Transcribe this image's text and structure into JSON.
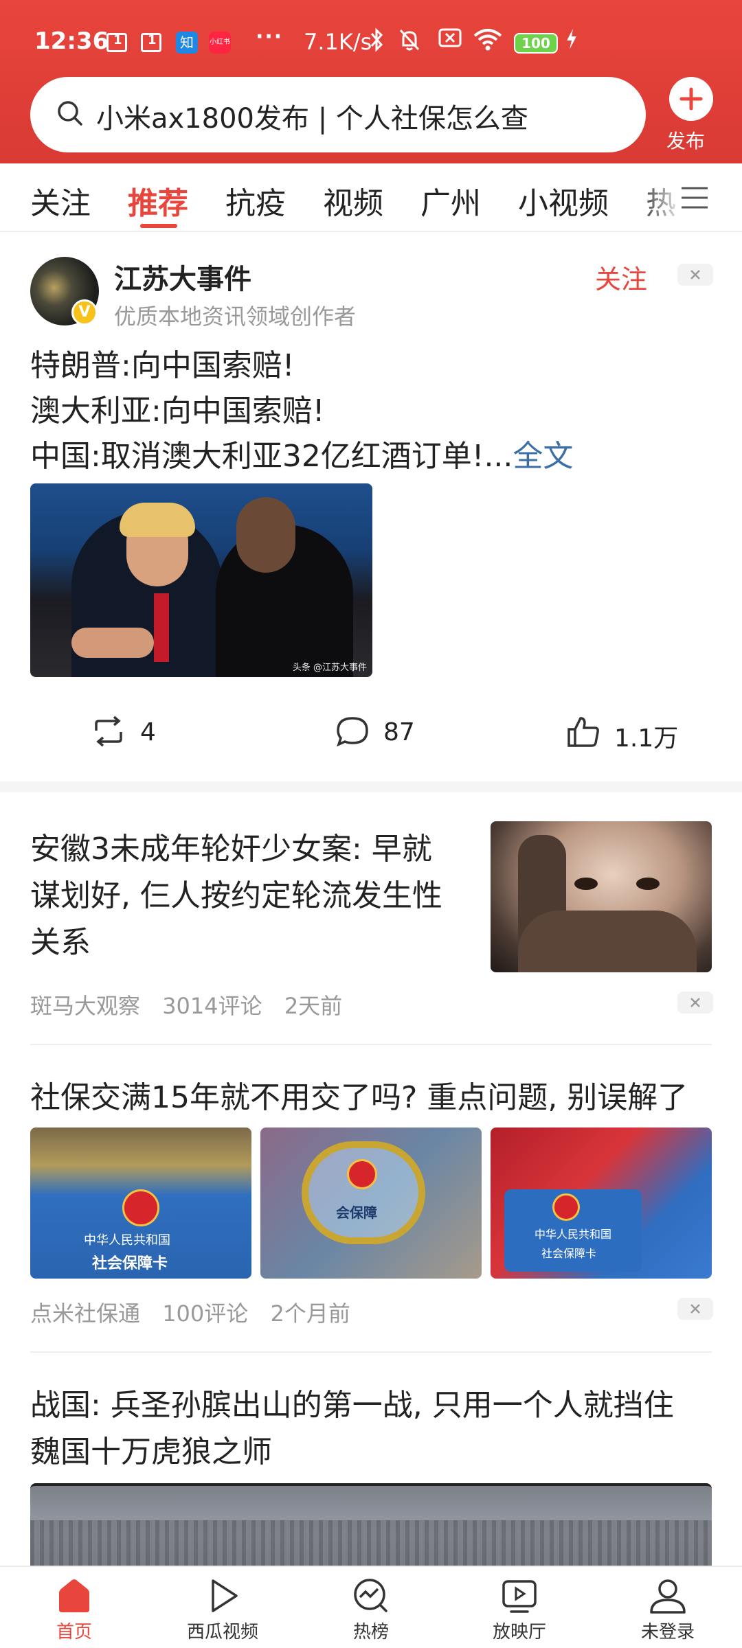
{
  "status_bar": {
    "time": "12:36",
    "notif_1": "1",
    "notif_2": "1",
    "zhihu": "知",
    "xiaohongshu": "小红书",
    "dots": "···",
    "net_speed": "7.1K/s",
    "battery": "100"
  },
  "search": {
    "query": "小米ax1800发布 | 个人社保怎么查",
    "publish_label": "发布"
  },
  "tabs": [
    "关注",
    "推荐",
    "抗疫",
    "视频",
    "广州",
    "小视频",
    "热"
  ],
  "active_tab": 1,
  "post": {
    "author": "江苏大事件",
    "author_badge": "V",
    "author_desc": "优质本地资讯领域创作者",
    "follow_label": "关注",
    "lines": [
      "特朗普:向中国索赔!",
      "澳大利亚:向中国索赔!",
      "中国:取消澳大利亚32亿红酒订单!..."
    ],
    "fulltext_label": "全文",
    "image_credit": "头条 @江苏大事件",
    "repost_count": "4",
    "comment_count": "87",
    "like_count": "1.1万"
  },
  "article1": {
    "title_lines": [
      "安徽3未成年轮奸少女案: 早就",
      "谋划好, 仨人按约定轮流发生性",
      "关系"
    ],
    "source": "斑马大观察",
    "comments": "3014评论",
    "time": "2天前"
  },
  "article2": {
    "title": "社保交满15年就不用交了吗? 重点问题, 别误解了",
    "card_text_1": "中华人民共和国",
    "card_text_2": "社会保障卡",
    "card_text_3": "会保障",
    "source": "点米社保通",
    "comments": "100评论",
    "time": "2个月前"
  },
  "article3": {
    "title_lines": [
      "战国: 兵圣孙膑出山的第一战, 只用一个人就挡住",
      "魏国十万虎狼之师"
    ]
  },
  "bottom_nav": [
    {
      "label": "首页",
      "icon": "home-icon"
    },
    {
      "label": "西瓜视频",
      "icon": "play-icon"
    },
    {
      "label": "热榜",
      "icon": "trending-icon"
    },
    {
      "label": "放映厅",
      "icon": "screening-room-icon"
    },
    {
      "label": "未登录",
      "icon": "user-icon"
    }
  ],
  "colors": {
    "accent": "#e8453c",
    "link": "#3b6fa6",
    "meta": "#999999"
  }
}
